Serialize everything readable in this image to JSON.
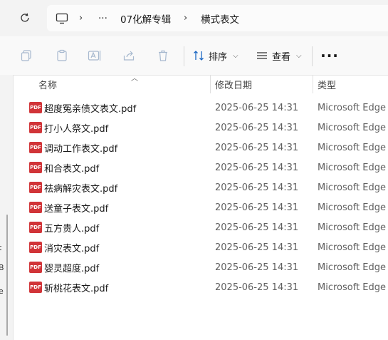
{
  "breadcrumb": {
    "overflow": "···",
    "folder1": "07化解专辑",
    "folder2": "横式表文"
  },
  "toolbar": {
    "sort_label": "排序",
    "view_label": "查看",
    "more": "···"
  },
  "columns": {
    "name": "名称",
    "date": "修改日期",
    "type": "类型"
  },
  "files": [
    {
      "name": "超度冤亲债文表文.pdf",
      "date": "2025-06-25 14:31",
      "type": "Microsoft Edge ..."
    },
    {
      "name": "打小人祭文.pdf",
      "date": "2025-06-25 14:31",
      "type": "Microsoft Edge ..."
    },
    {
      "name": "调动工作表文.pdf",
      "date": "2025-06-25 14:31",
      "type": "Microsoft Edge ..."
    },
    {
      "name": "和合表文.pdf",
      "date": "2025-06-25 14:31",
      "type": "Microsoft Edge ..."
    },
    {
      "name": "祛病解灾表文.pdf",
      "date": "2025-06-25 14:31",
      "type": "Microsoft Edge ..."
    },
    {
      "name": "送童子表文.pdf",
      "date": "2025-06-25 14:31",
      "type": "Microsoft Edge ..."
    },
    {
      "name": "五方贵人.pdf",
      "date": "2025-06-25 14:31",
      "type": "Microsoft Edge ..."
    },
    {
      "name": "消灾表文.pdf",
      "date": "2025-06-25 14:31",
      "type": "Microsoft Edge ..."
    },
    {
      "name": "婴灵超度.pdf",
      "date": "2025-06-25 14:31",
      "type": "Microsoft Edge ..."
    },
    {
      "name": "斩桃花表文.pdf",
      "date": "2025-06-25 14:31",
      "type": "Microsoft Edge ..."
    }
  ],
  "file_icon_text": "PDF",
  "sidebar_fragments": [
    "t",
    "B",
    "e"
  ],
  "colors": {
    "pdf_icon": "#d13438",
    "toolbar_bg": "#f9f9f9",
    "topbar_bg": "#f3f3f3"
  }
}
